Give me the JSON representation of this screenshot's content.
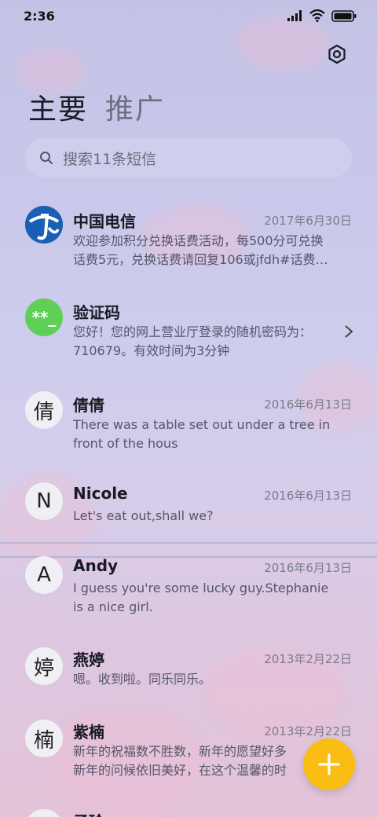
{
  "status_bar": {
    "time": "2:36"
  },
  "header": {
    "tab_main": "主要",
    "tab_promo": "推广"
  },
  "search": {
    "placeholder": "搜索11条短信"
  },
  "verification_avatar_text": "**_",
  "conversations": [
    {
      "name": "中国电信",
      "date": "2017年6月30日",
      "line1": "欢迎参加积分兑换话费活动，每500分可兑换",
      "line2": "话费5元，兑换话费请回复106或jfdh#话费…"
    },
    {
      "name": "验证码",
      "date": "",
      "line1": "您好！您的网上营业厅登录的随机密码为：",
      "line2": "710679。有效时间为3分钟"
    },
    {
      "avatar": "倩",
      "name": "倩倩",
      "date": "2016年6月13日",
      "line1": "There was a table set out under a tree in",
      "line2": "front of the hous"
    },
    {
      "avatar": "N",
      "name": "Nicole",
      "date": "2016年6月13日",
      "line1": "Let's eat out,shall we?",
      "line2": ""
    },
    {
      "avatar": "A",
      "name": "Andy",
      "date": "2016年6月13日",
      "line1": "I guess you're some lucky guy.Stephanie",
      "line2": "is a nice girl."
    },
    {
      "avatar": "婷",
      "name": "燕婷",
      "date": "2013年2月22日",
      "line1": "嗯。收到啦。同乐同乐。",
      "line2": ""
    },
    {
      "avatar": "楠",
      "name": "紫楠",
      "date": "2013年2月22日",
      "line1": "新年的祝福数不胜数，新年的愿望好多",
      "line2": "新年的问候依旧美好，在这个温馨的时"
    },
    {
      "avatar": "",
      "name": "子玲",
      "date": "",
      "line1": "",
      "line2": ""
    }
  ],
  "colors": {
    "fab": "#f9bd14",
    "verification_avatar": "#5fcf55",
    "telecom_blue": "#1a5fb4"
  }
}
